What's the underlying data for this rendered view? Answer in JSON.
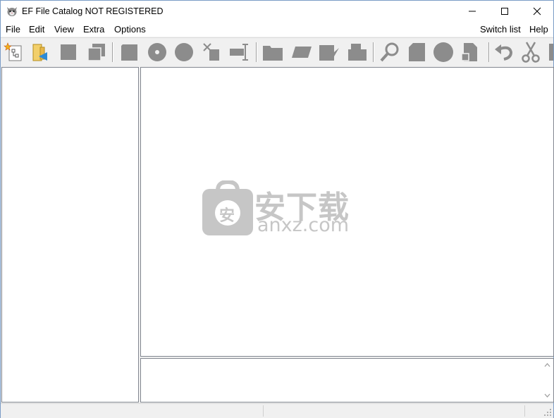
{
  "window": {
    "title": "EF File Catalog NOT REGISTERED"
  },
  "menu": {
    "left": [
      "File",
      "Edit",
      "View",
      "Extra",
      "Options"
    ],
    "right": [
      "Switch list",
      "Help"
    ]
  },
  "toolbar": {
    "icons": [
      "new-catalog-icon",
      "open-folder-icon",
      "stop-icon",
      "copy-icon",
      "catalog-disk-icon",
      "cd-icon",
      "disk-icon",
      "delete-icon",
      "rename-icon",
      "folder-icon",
      "edit-icon",
      "tag-icon",
      "properties-icon",
      "search-icon",
      "document-icon",
      "record-icon",
      "export-icon",
      "undo-icon",
      "cut-icon",
      "more-icon"
    ]
  },
  "watermark": {
    "cn": "安下载",
    "en": "anxz.com",
    "badge": "安"
  },
  "colors": {
    "accent": "#7a9cc6",
    "icon_gray": "#8c8c8c",
    "watermark": "#c6c6c6"
  }
}
